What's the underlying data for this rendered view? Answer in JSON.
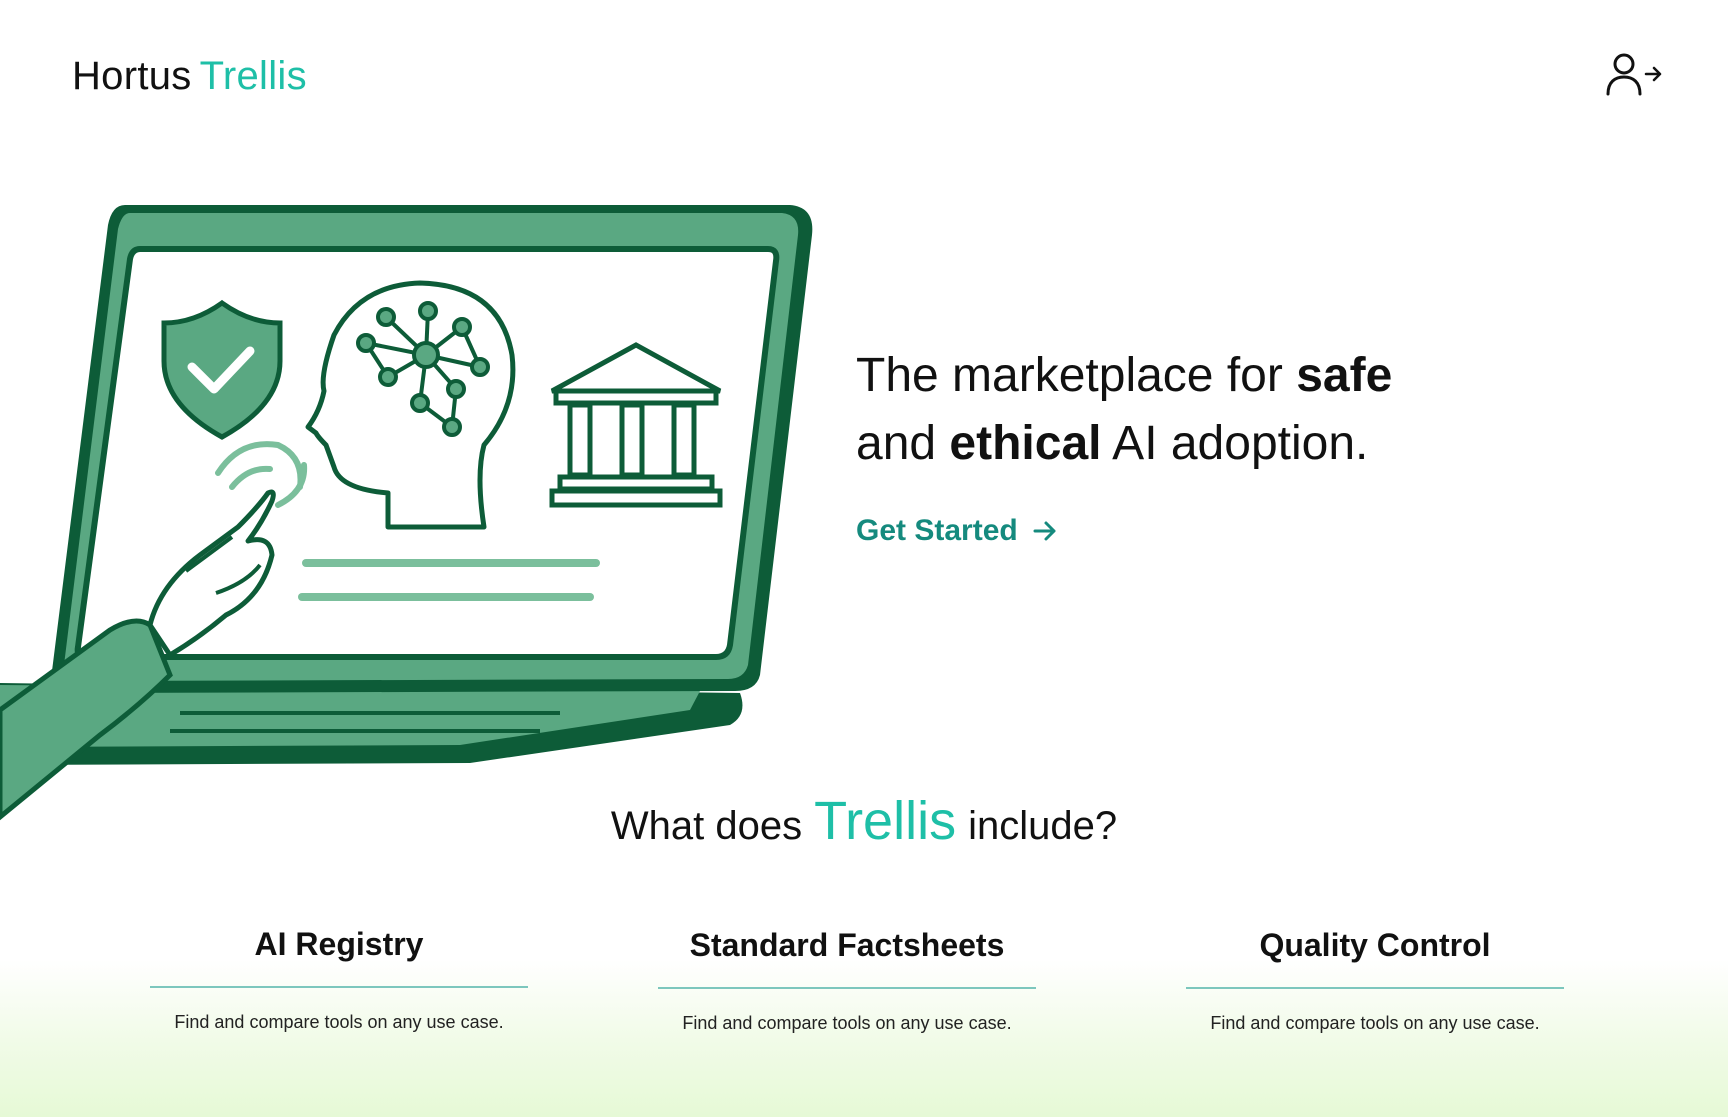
{
  "header": {
    "logo_word_1": "Hortus",
    "logo_word_2": "Trellis",
    "account_icon": "user-arrow-right-icon"
  },
  "hero": {
    "headline_1": "The marketplace for ",
    "headline_bold_1": "safe",
    "headline_2": "and ",
    "headline_bold_2": "ethical",
    "headline_3": " AI adoption.",
    "cta_label": "Get Started",
    "cta_icon": "arrow-right-icon",
    "illustration_icons": [
      "shield-check-icon",
      "brain-network-icon",
      "government-building-icon",
      "pointing-hand-icon"
    ]
  },
  "includes": {
    "title_before": "What does",
    "title_brand": "Trellis",
    "title_after": "include?",
    "features": [
      {
        "title": "AI Registry",
        "description": "Find and compare tools on any use case."
      },
      {
        "title": "Standard Factsheets",
        "description": "Find and compare tools on any use case."
      },
      {
        "title": "Quality Control",
        "description": "Find and compare tools on any use case."
      }
    ]
  },
  "colors": {
    "accent_teal": "#1ebfa7",
    "cta_teal": "#158a7e",
    "illustration_dark": "#0d5c38",
    "illustration_mid": "#5aa882",
    "illustration_light": "#7bbf9c",
    "footer_green": "#e6f9d6"
  }
}
